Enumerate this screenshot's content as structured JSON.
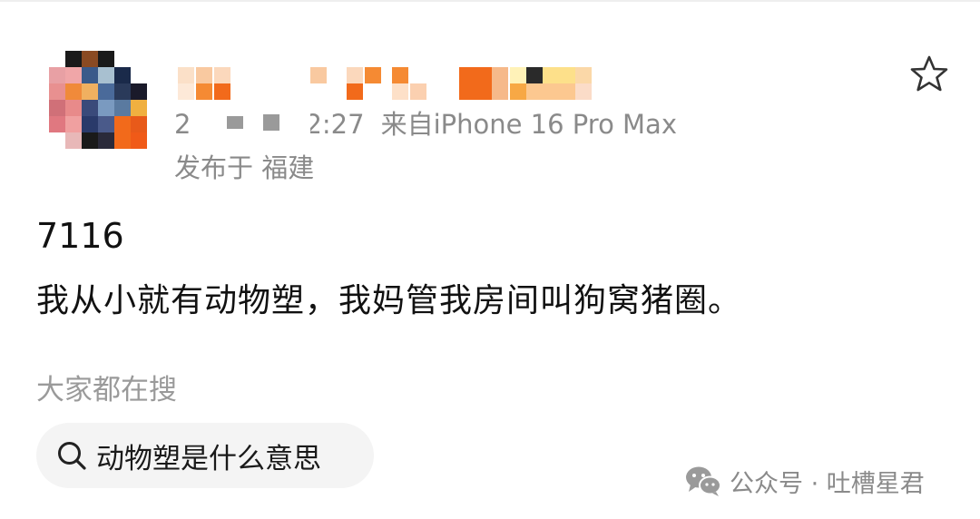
{
  "post": {
    "author": {
      "avatar_icon": "pixelated-avatar",
      "name_icon": "pixelated-username"
    },
    "meta": {
      "time_prefix": "2",
      "time_suffix": "2:27",
      "source_text": "来自iPhone 16 Pro Max",
      "location_text": "发布于 福建"
    },
    "favorite_icon": "star-outline-icon",
    "number": "7116",
    "text": "我从小就有动物塑，我妈管我房间叫狗窝猪圈。"
  },
  "trending": {
    "label": "大家都在搜",
    "search_chip": {
      "icon": "search-icon",
      "text": "动物塑是什么意思"
    }
  },
  "watermark": {
    "icon": "wechat-icon",
    "text": "公众号 · 吐槽星君"
  },
  "colors": {
    "text_primary": "#111111",
    "text_secondary": "#8a8a8a",
    "chip_background": "#f4f4f4",
    "avatar_orange": "#f26a1b",
    "username_orange": "#f58a33"
  }
}
